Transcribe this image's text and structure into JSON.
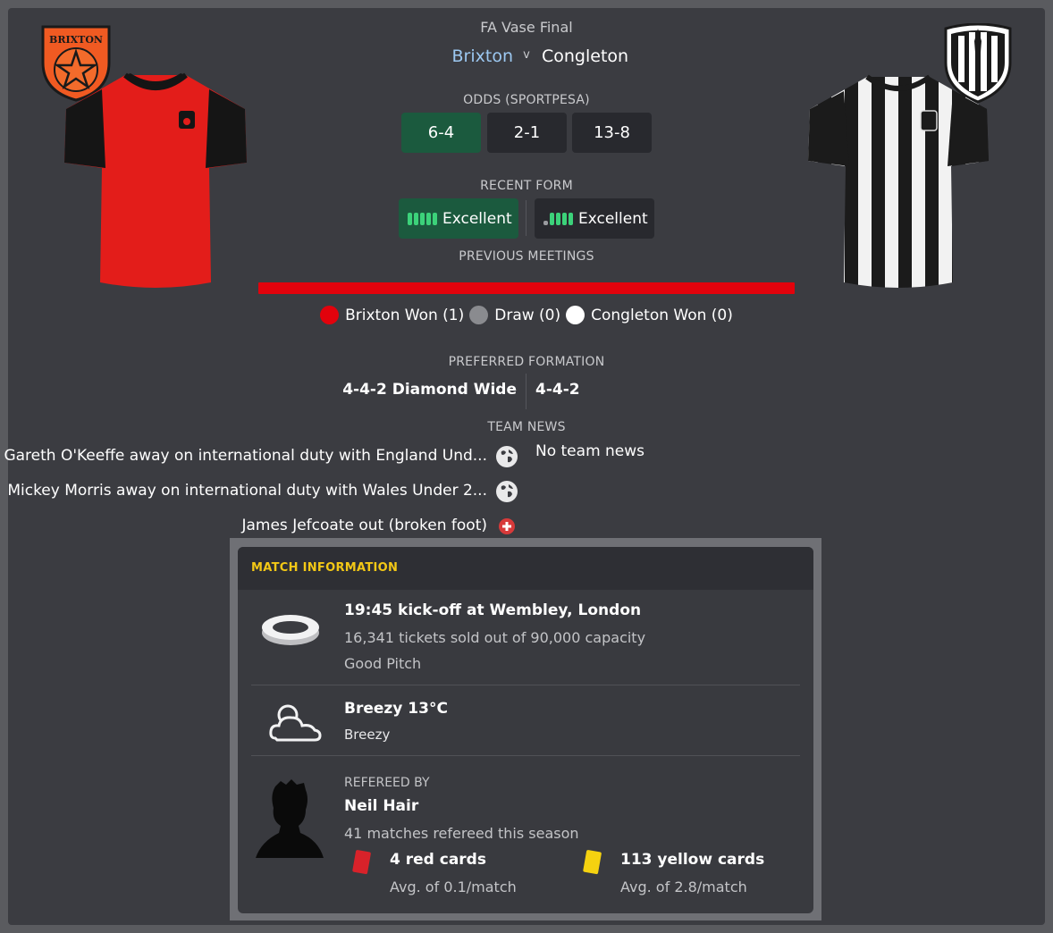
{
  "header": {
    "competition": "FA Vase Final",
    "home_team": "Brixton",
    "vs": "v",
    "away_team": "Congleton",
    "home_crest_text": "BRIXTON"
  },
  "odds": {
    "label": "ODDS (SPORTPESA)",
    "values": [
      "6-4",
      "2-1",
      "13-8"
    ]
  },
  "recent_form": {
    "label": "RECENT FORM",
    "home": "Excellent",
    "away": "Excellent"
  },
  "previous_meetings": {
    "label": "PREVIOUS MEETINGS",
    "home_won": "Brixton Won (1)",
    "draw": "Draw (0)",
    "away_won": "Congleton Won (0)",
    "home_color": "#e2020c",
    "draw_color": "#8a8b8f",
    "away_color": "#ffffff"
  },
  "formation": {
    "label": "PREFERRED FORMATION",
    "home": "4-4-2 Diamond Wide",
    "away": "4-4-2"
  },
  "team_news": {
    "label": "TEAM NEWS",
    "home": [
      {
        "text": "Gareth O'Keeffe away on international duty with England Und...",
        "icon": "globe-icon"
      },
      {
        "text": "Mickey Morris away on international duty with Wales Under 2...",
        "icon": "globe-icon"
      },
      {
        "text": "James Jefcoate out (broken foot)",
        "icon": "injury-icon"
      }
    ],
    "away": "No team news"
  },
  "match_info": {
    "title": "MATCH INFORMATION",
    "venue": {
      "kickoff": "19:45 kick-off at Wembley, London",
      "tickets": "16,341 tickets sold out of 90,000 capacity",
      "pitch": "Good Pitch",
      "icon": "stadium-icon"
    },
    "weather": {
      "summary": "Breezy 13°C",
      "detail": "Breezy",
      "icon": "weather-icon"
    },
    "referee": {
      "label": "REFEREED BY",
      "name": "Neil Hair",
      "matches": "41 matches refereed this season",
      "red_cards": "4 red cards",
      "red_avg": "Avg. of 0.1/match",
      "yellow_cards": "113 yellow cards",
      "yellow_avg": "Avg. of 2.8/match",
      "icon": "referee-silhouette"
    }
  },
  "colors": {
    "accent_yellow": "#f3c816",
    "favourite_green": "#1b5a3e",
    "home_kit": "#e31d1a",
    "home_name": "#9cc8f1"
  }
}
